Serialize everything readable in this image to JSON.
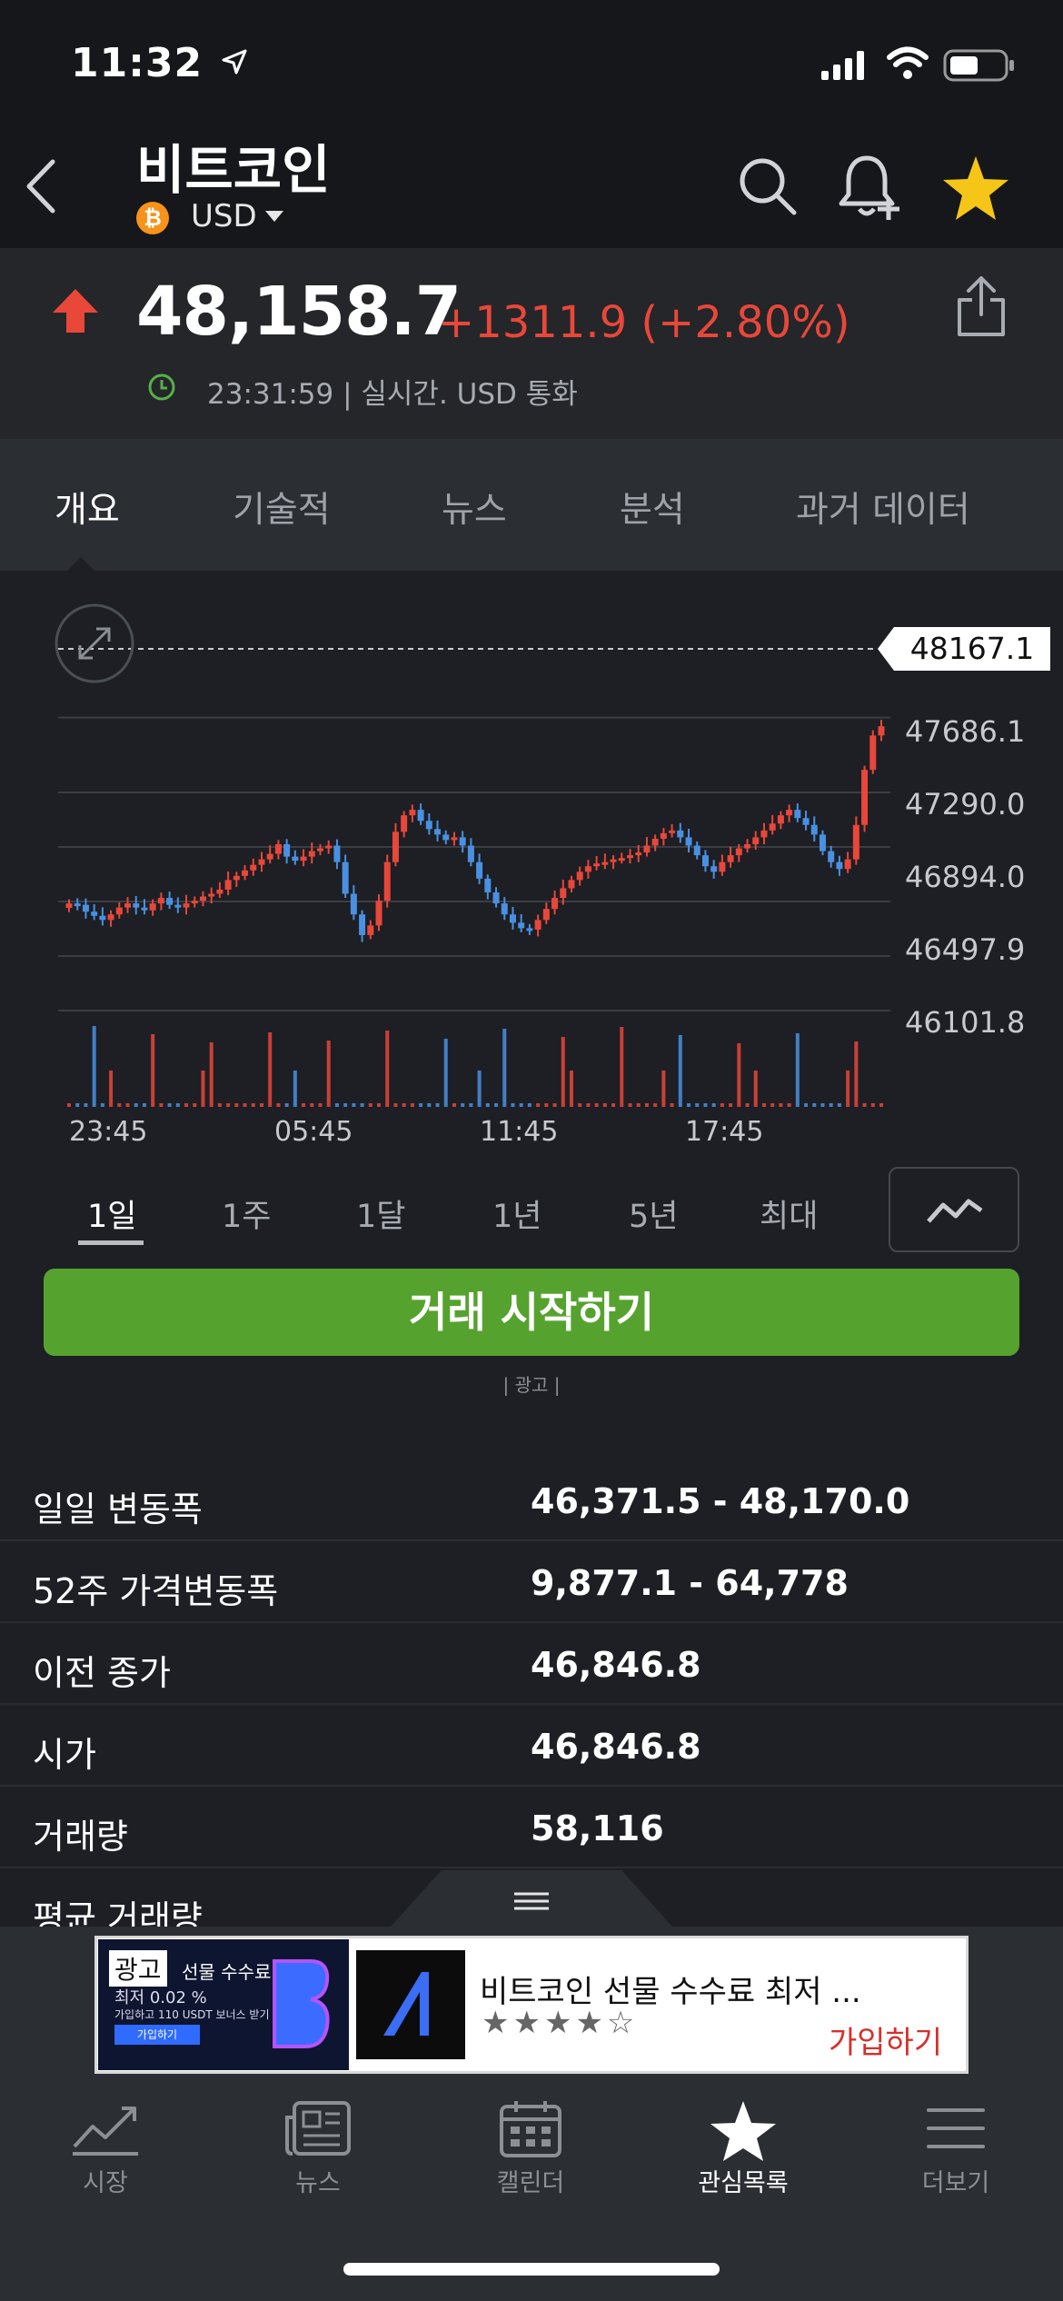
{
  "status_bar": {
    "time": "11:32"
  },
  "header": {
    "title": "비트코인",
    "currency": "USD",
    "coin_badge": "₿"
  },
  "price": {
    "value": "48,158.7",
    "change": "+1311.9 (+2.80%)",
    "meta": "23:31:59 | 실시간. USD 통화",
    "colors": {
      "down": "#4a90e2",
      "up": "#e8473a"
    }
  },
  "tabs": [
    "개요",
    "기술적",
    "뉴스",
    "분석",
    "과거 데이터"
  ],
  "active_tab": 0,
  "chart_data": {
    "type": "candlestick",
    "last_price": "48167.1",
    "y_ticks": [
      "47686.1",
      "47290.0",
      "46894.0",
      "46497.9",
      "46101.8"
    ],
    "x_ticks": [
      "23:45",
      "05:45",
      "11:45",
      "17:45"
    ],
    "ylim": [
      46000,
      48300
    ],
    "close_path": [
      46880,
      46870,
      46820,
      46790,
      46760,
      46800,
      46850,
      46880,
      46850,
      46830,
      46880,
      46920,
      46870,
      46850,
      46880,
      46900,
      46930,
      46950,
      46980,
      47050,
      47080,
      47120,
      47160,
      47200,
      47240,
      47310,
      47220,
      47190,
      47220,
      47260,
      47280,
      47300,
      47180,
      46950,
      46800,
      46650,
      46720,
      46900,
      47180,
      47400,
      47520,
      47560,
      47480,
      47420,
      47380,
      47340,
      47360,
      47300,
      47180,
      47060,
      46960,
      46880,
      46800,
      46740,
      46700,
      46690,
      46760,
      46840,
      46920,
      46990,
      47050,
      47110,
      47150,
      47170,
      47180,
      47200,
      47210,
      47230,
      47250,
      47300,
      47350,
      47390,
      47410,
      47360,
      47300,
      47230,
      47150,
      47110,
      47180,
      47230,
      47280,
      47310,
      47360,
      47410,
      47460,
      47520,
      47560,
      47500,
      47450,
      47380,
      47260,
      47180,
      47130,
      47200,
      47450,
      47850,
      48100,
      48167
    ]
  },
  "ranges": [
    "1일",
    "1주",
    "1달",
    "1년",
    "5년",
    "최대"
  ],
  "active_range": 0,
  "trade_button": "거래 시작하기",
  "ad_small_label": "| 광고 |",
  "stats": [
    {
      "label": "일일 변동폭",
      "value": "46,371.5 - 48,170.0"
    },
    {
      "label": "52주 가격변동폭",
      "value": "9,877.1 - 64,778"
    },
    {
      "label": "이전 종가",
      "value": "46,846.8"
    },
    {
      "label": "시가",
      "value": "46,846.8"
    },
    {
      "label": "거래량",
      "value": "58,116"
    },
    {
      "label": "평균 거래량",
      "value": ""
    }
  ],
  "ad": {
    "tag": "광고",
    "thumb_title": "선물 수수료",
    "thumb_sub": "최저 0.02 %",
    "thumb_sub2": "가입하고 110 USDT 보너스 받기",
    "thumb_btn": "가입하기",
    "title": "비트코인 선물 수수료 최저 ...",
    "stars": "★★★★☆",
    "cta": "가입하기"
  },
  "bottom_nav": [
    {
      "label": "시장",
      "icon": "market-chart-icon"
    },
    {
      "label": "뉴스",
      "icon": "news-icon"
    },
    {
      "label": "캘린더",
      "icon": "calendar-icon"
    },
    {
      "label": "관심목록",
      "icon": "star-icon"
    },
    {
      "label": "더보기",
      "icon": "menu-icon"
    }
  ],
  "active_nav": 3
}
